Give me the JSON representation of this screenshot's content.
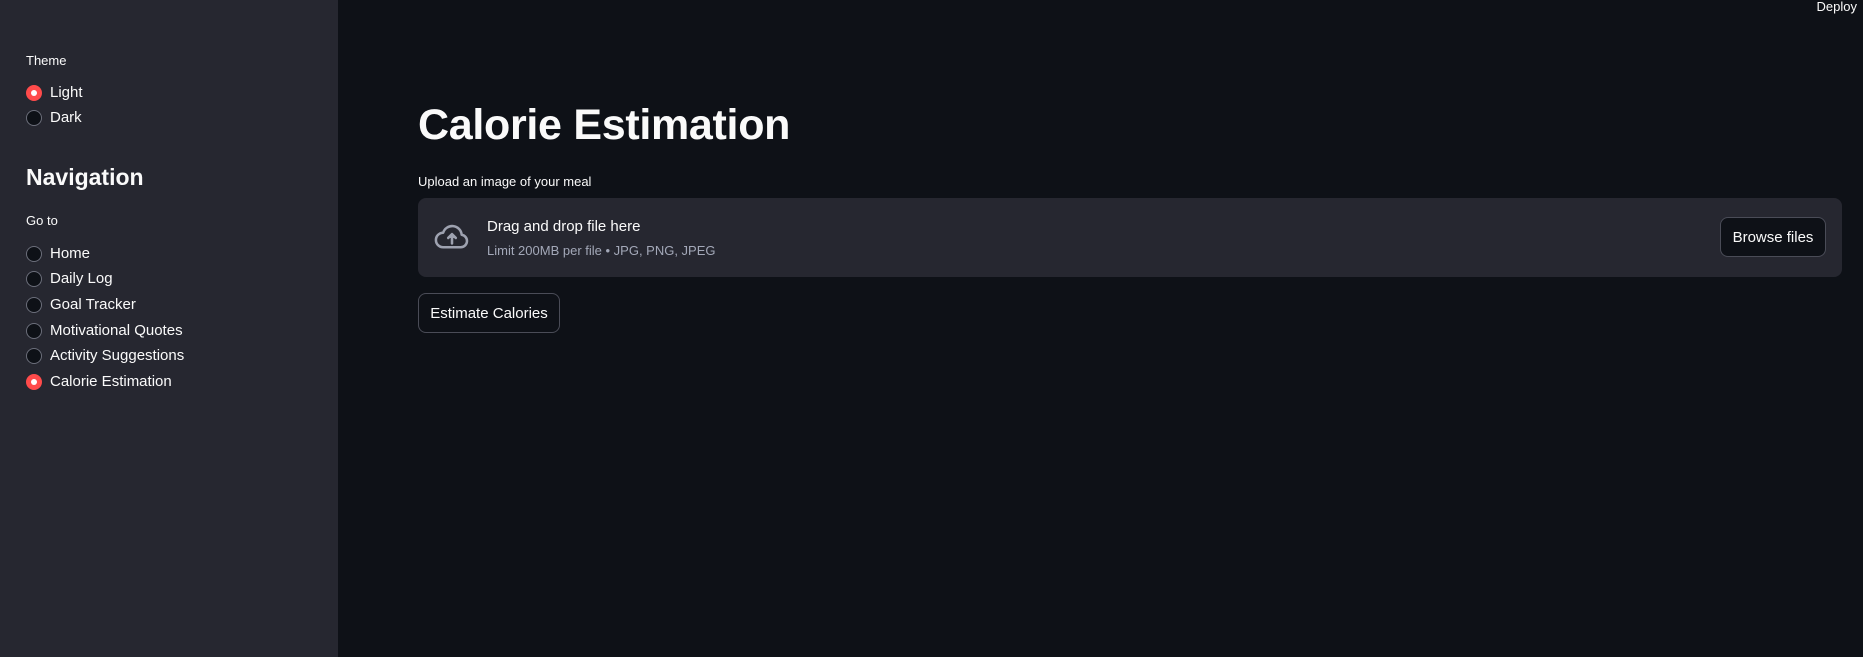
{
  "header": {
    "deploy_label": "Deploy"
  },
  "sidebar": {
    "theme_label": "Theme",
    "theme_options": [
      {
        "label": "Light",
        "checked": true
      },
      {
        "label": "Dark",
        "checked": false
      }
    ],
    "nav_heading": "Navigation",
    "goto_label": "Go to",
    "nav_options": [
      {
        "label": "Home",
        "checked": false
      },
      {
        "label": "Daily Log",
        "checked": false
      },
      {
        "label": "Goal Tracker",
        "checked": false
      },
      {
        "label": "Motivational Quotes",
        "checked": false
      },
      {
        "label": "Activity Suggestions",
        "checked": false
      },
      {
        "label": "Calorie Estimation",
        "checked": true
      }
    ]
  },
  "main": {
    "title": "Calorie Estimation",
    "upload_label": "Upload an image of your meal",
    "dropzone": {
      "title": "Drag and drop file here",
      "hint": "Limit 200MB per file • JPG, PNG, JPEG",
      "browse_label": "Browse files",
      "icon": "cloud-upload-icon"
    },
    "estimate_label": "Estimate Calories"
  },
  "colors": {
    "background": "#0e1117",
    "sidebar": "#262730",
    "accent": "#ff4b4b",
    "text": "#fafafa",
    "muted_text": "#a3a8b8"
  }
}
